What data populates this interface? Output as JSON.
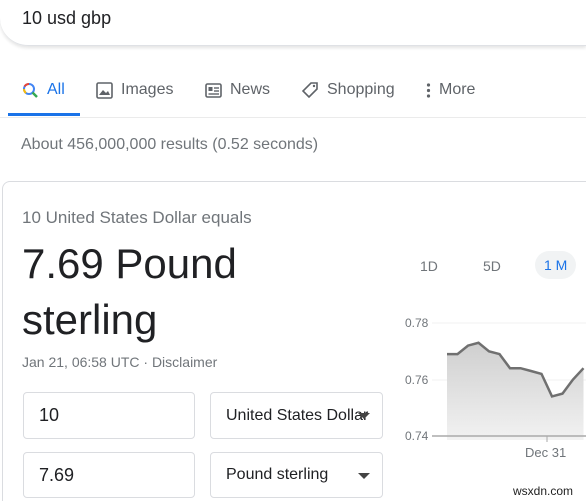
{
  "search": {
    "query": "10 usd gbp"
  },
  "tabs": [
    {
      "label": "All",
      "icon": "search-icon",
      "active": true
    },
    {
      "label": "Images",
      "icon": "image-icon"
    },
    {
      "label": "News",
      "icon": "news-icon"
    },
    {
      "label": "Shopping",
      "icon": "tag-icon"
    },
    {
      "label": "More",
      "icon": "more-vert-icon"
    }
  ],
  "stats": "About 456,000,000 results (0.52 seconds)",
  "converter": {
    "equals": "10 United States Dollar equals",
    "result": "7.69 Pound sterling",
    "date": "Jan 21, 06:58 UTC · Disclaimer",
    "amount_from": "10",
    "currency_from": "United States Dollar",
    "amount_to": "7.69",
    "currency_to": "Pound sterling"
  },
  "chart_data": {
    "type": "area",
    "ranges": [
      "1D",
      "5D",
      "1 M"
    ],
    "active_range": "1 M",
    "y_ticks": [
      "0.78",
      "0.76",
      "0.74"
    ],
    "ylim": [
      0.74,
      0.78
    ],
    "x_ticks": [
      "Dec 31"
    ],
    "values": [
      0.769,
      0.769,
      0.772,
      0.773,
      0.77,
      0.769,
      0.764,
      0.764,
      0.763,
      0.762,
      0.754,
      0.755,
      0.76,
      0.764
    ],
    "line_color": "#707070"
  },
  "watermark": "wsxdn.com"
}
